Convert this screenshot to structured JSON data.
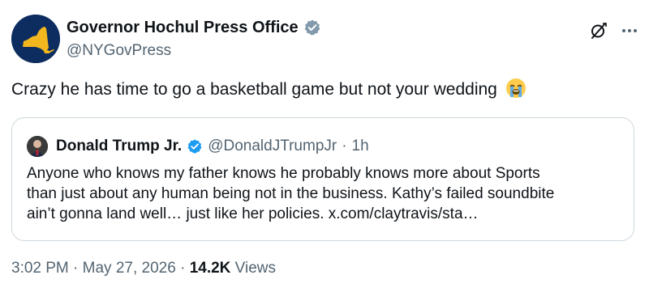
{
  "author": {
    "name": "Governor Hochul Press Office",
    "handle": "@NYGovPress",
    "avatar_icon": "new-york-state-map-icon",
    "verified_icon": "verified-badge-gray-icon"
  },
  "actions": {
    "grok_icon": "grok-icon",
    "more_icon": "more-icon"
  },
  "tweet": {
    "text": "Crazy he has time to go a basketball game but not your wedding",
    "emoji_icon": "loudly-crying-face-emoji"
  },
  "quote": {
    "name": "Donald Trump Jr.",
    "handle": "@DonaldJTrumpJr",
    "separator": "·",
    "time": "1h",
    "verified_icon": "verified-badge-blue-icon",
    "lines": [
      "Anyone who knows my father knows he probably knows more about Sports",
      "than just about any human being not in the business. Kathy’s failed soundbite",
      "ain’t gonna land well… just like her policies. x.com/claytravis/sta…"
    ]
  },
  "meta": {
    "time": "3:02 PM",
    "sep1": "·",
    "date": "May 27, 2026",
    "sep2": "·",
    "views_count": "14.2K",
    "views_label": "Views"
  },
  "colors": {
    "text_primary": "#0f1419",
    "text_secondary": "#536471",
    "border": "#cfd9de",
    "avatar_bg": "#0d2c5f",
    "state_gold": "#f2b71f",
    "verified_gray": "#829aab",
    "verified_blue": "#1d9bf0"
  }
}
